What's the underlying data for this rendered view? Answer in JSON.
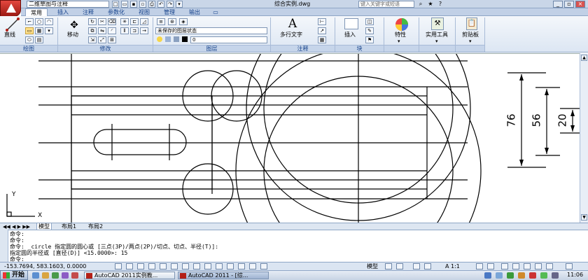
{
  "titlebar": {
    "workspace": "二维草图与注释",
    "document_title": "综合实例.dwg",
    "help_placeholder": "键入关键字或短语"
  },
  "tabs": [
    {
      "label": "常用",
      "active": true
    },
    {
      "label": "插入",
      "active": false
    },
    {
      "label": "注释",
      "active": false
    },
    {
      "label": "参数化",
      "active": false
    },
    {
      "label": "视图",
      "active": false
    },
    {
      "label": "管理",
      "active": false
    },
    {
      "label": "输出",
      "active": false
    }
  ],
  "ribbon": {
    "line_label": "直线",
    "move_label": "移动",
    "layer_state": "未保存的图层状态",
    "layer_current": "0",
    "text_label": "多行文字",
    "insert_label": "插入",
    "properties_label": "特性",
    "utilities_label": "实用工具",
    "clipboard_label": "剪贴板",
    "panels": {
      "draw": "绘图",
      "modify": "修改",
      "layers": "图层",
      "annotation": "注释",
      "block": "块"
    }
  },
  "drawing": {
    "dimensions": [
      "76",
      "56",
      "20"
    ],
    "ucs_x": "X",
    "ucs_y": "Y"
  },
  "layout_tabs": [
    {
      "label": "模型",
      "active": true
    },
    {
      "label": "布局1",
      "active": false
    },
    {
      "label": "布局2",
      "active": false
    }
  ],
  "command": {
    "lines": [
      "命令:",
      "命令:",
      "命令:  _circle 指定圆的圆心或 [三点(3P)/两点(2P)/切点、切点、半径(T)]:",
      "指定圆的半径或 [直径(D)] <15.0000>: 15",
      "命令:"
    ]
  },
  "status": {
    "coords": "-153.7694, 583.1603, 0.0000",
    "model_label": "模型",
    "scale": "A 1:1"
  },
  "taskbar": {
    "start": "开始",
    "tasks": [
      {
        "label": "AutoCAD 2011实例教...",
        "active": false
      },
      {
        "label": "AutoCAD 2011 - [综...",
        "active": true
      }
    ],
    "clock": "11:06"
  },
  "colors": {
    "ribbon_bg": "#dce6f1",
    "accent_red": "#b31f17",
    "panel_text": "#15428b"
  }
}
